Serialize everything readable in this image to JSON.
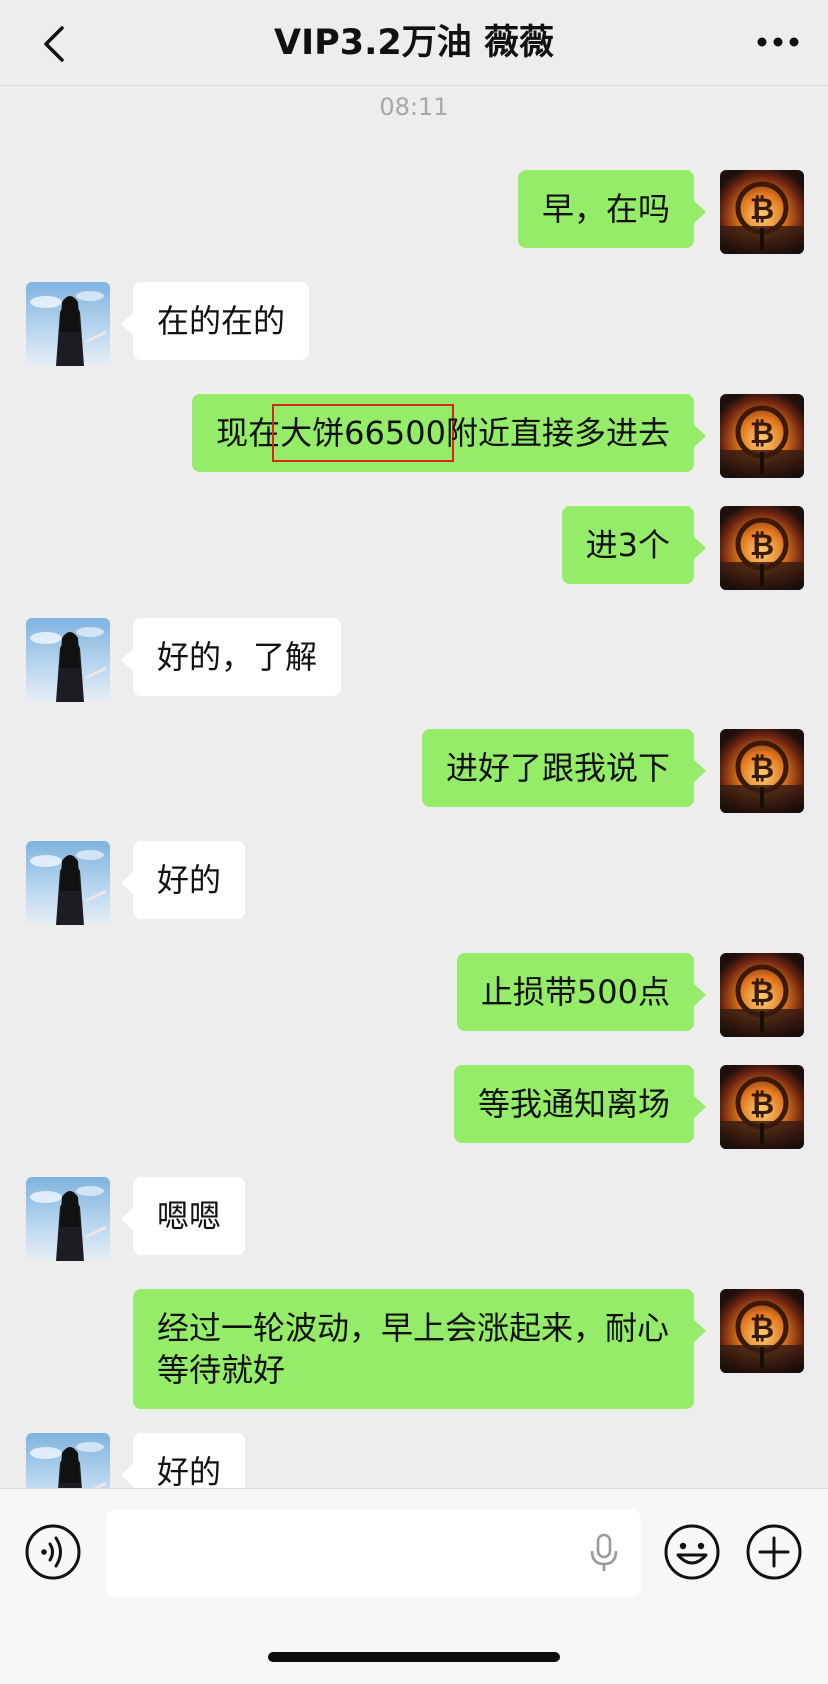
{
  "header": {
    "title": "VIP3.2万油 薇薇"
  },
  "timestamp": "08:11",
  "messages": [
    {
      "side": "out",
      "text": "早，在吗"
    },
    {
      "side": "in",
      "text": "在的在的"
    },
    {
      "side": "out",
      "text_before": "现在",
      "text_highlight": "大饼66500",
      "text_after": "附近直接多进去"
    },
    {
      "side": "out",
      "text": "进3个"
    },
    {
      "side": "in",
      "text": "好的，了解"
    },
    {
      "side": "out",
      "text": "进好了跟我说下"
    },
    {
      "side": "in",
      "text": "好的"
    },
    {
      "side": "out",
      "text": "止损带500点"
    },
    {
      "side": "out",
      "text": "等我通知离场"
    },
    {
      "side": "in",
      "text": "嗯嗯"
    },
    {
      "side": "out",
      "text": "经过一轮波动，早上会涨起来，耐心等待就好"
    },
    {
      "side": "in",
      "text": "好的"
    }
  ],
  "input_bar": {
    "placeholder": "",
    "value": ""
  },
  "colors": {
    "outgoing_bubble": "#95ec69",
    "incoming_bubble": "#ffffff",
    "background": "#ededed",
    "highlight_box": "#d8261c"
  },
  "icons": {
    "back": "chevron-left-icon",
    "more": "more-dots-icon",
    "voice": "voice-wave-icon",
    "mic": "microphone-icon",
    "emoji": "smiley-icon",
    "plus": "plus-circle-icon",
    "my_avatar": "bitcoin-sunset-avatar",
    "contact_avatar": "woman-sky-avatar"
  }
}
